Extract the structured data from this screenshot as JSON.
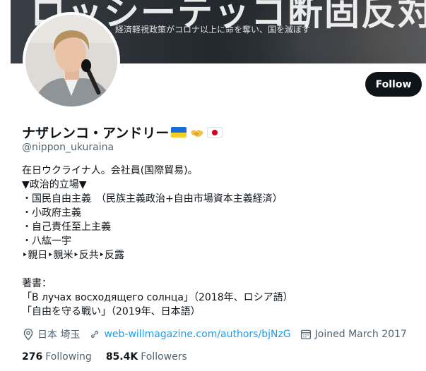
{
  "banner": {
    "title": "ロッシーテッコ断固反対",
    "subtitle": "経済軽視政策がコロナ以上に命を奪い、国を滅ぼす"
  },
  "profile": {
    "display_name": "ナザレンコ・アンドリー",
    "handle": "@nippon_ukuraina",
    "follow_label": "Follow",
    "bio": "在日ウクライナ人。会社員(国際貿易)。\n▼政治的立場▼\n・国民自由主義　（民族主義政治+自由市場資本主義経済）\n・小政府主義\n・自己責任至上主義\n・八紘一宇\n‣親日‣親米‣反共‣反露\n\n著書：\n「В лучах восходящего солнца」（2018年、ロシア語）\n「自由を守る戦い」（2019年、日本語）",
    "location": "日本 埼玉",
    "website": "web-willmagazine.com/authors/bjNzG",
    "joined": "Joined March 2017",
    "following_count": "276",
    "following_label": "Following",
    "followers_count": "85.4K",
    "followers_label": "Followers"
  },
  "icons": [
    "location-icon",
    "link-icon",
    "calendar-icon",
    "ukraine-flag-icon",
    "handshake-icon",
    "japan-flag-icon"
  ],
  "colors": {
    "follow_bg": "#0f1419",
    "link": "#1d9bf0",
    "secondary_text": "#536471"
  }
}
